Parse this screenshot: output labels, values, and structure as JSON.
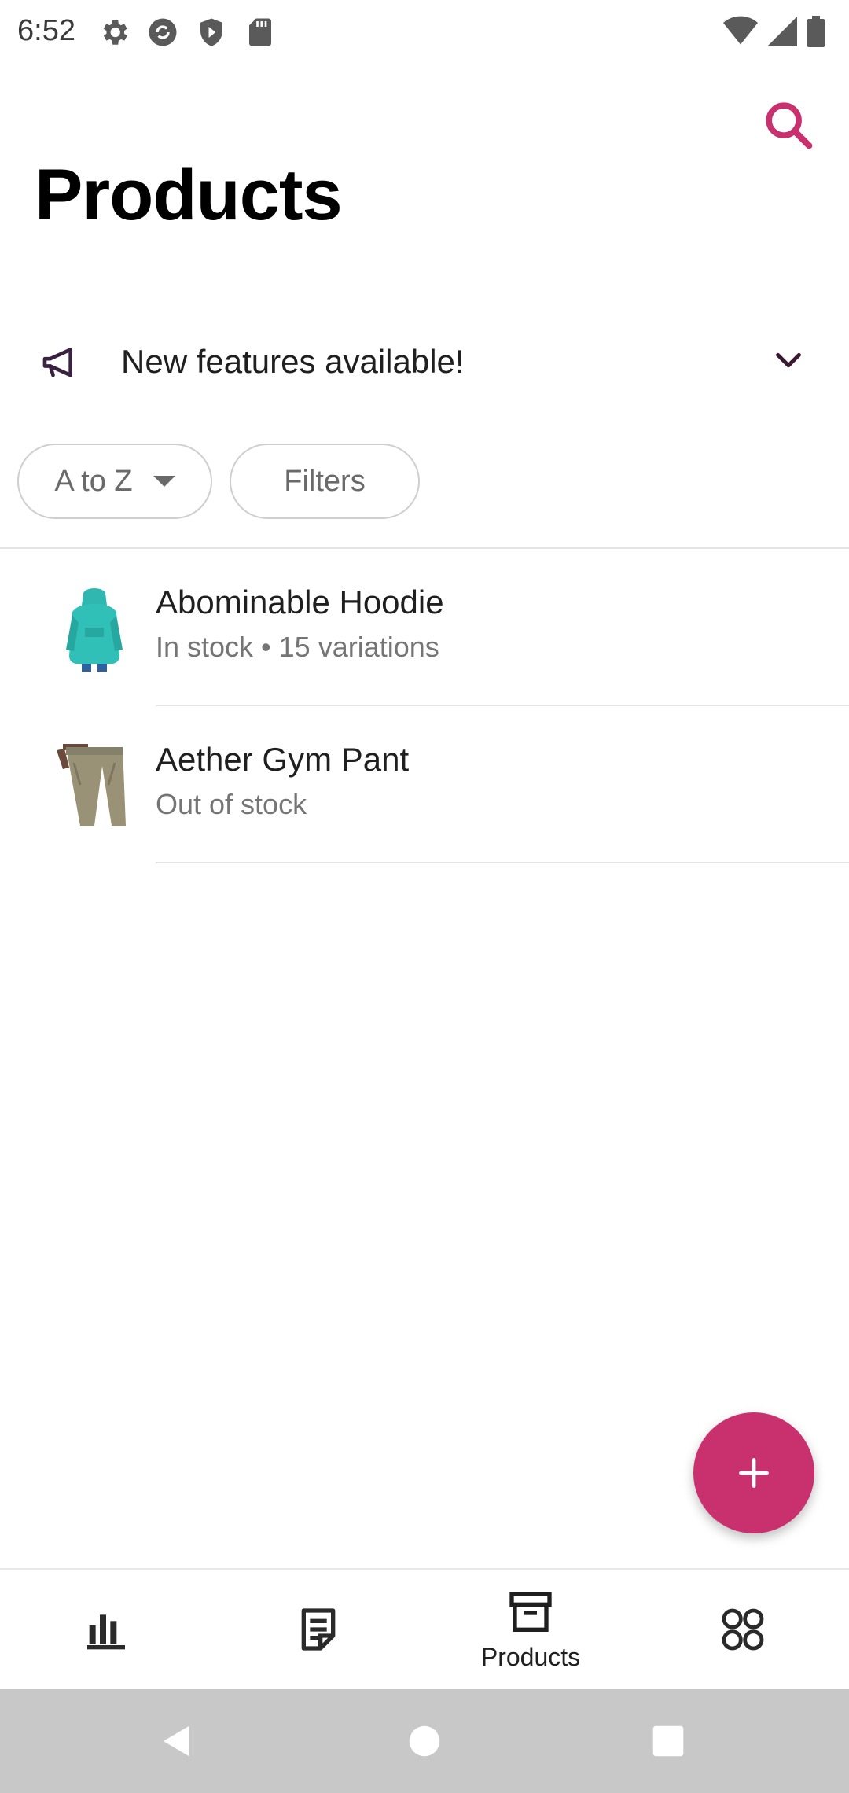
{
  "status_bar": {
    "time": "6:52",
    "left_icons": [
      "gear-icon",
      "sync-icon",
      "shield-icon",
      "sd-card-icon"
    ],
    "right_icons": [
      "wifi-icon",
      "cell-signal-icon",
      "battery-icon"
    ]
  },
  "header": {
    "title": "Products",
    "search_icon": "search-icon"
  },
  "banner": {
    "icon": "megaphone-icon",
    "text": "New features available!",
    "chevron": "chevron-down-icon"
  },
  "sort_chip": {
    "label": "A to Z"
  },
  "filter_chip": {
    "label": "Filters"
  },
  "products": [
    {
      "name": "Abominable Hoodie",
      "meta": "In stock • 15 variations",
      "thumb": "hoodie-image"
    },
    {
      "name": "Aether Gym Pant",
      "meta": "Out of stock",
      "thumb": "pants-image"
    }
  ],
  "fab": {
    "icon": "plus-icon"
  },
  "bottom_nav": {
    "items": [
      {
        "icon": "stats-icon",
        "label": ""
      },
      {
        "icon": "orders-icon",
        "label": ""
      },
      {
        "icon": "products-icon",
        "label": "Products"
      },
      {
        "icon": "menu-grid-icon",
        "label": ""
      }
    ]
  },
  "colors": {
    "accent": "#c9306e",
    "text_primary": "#1f1f1f",
    "text_secondary": "#757575"
  }
}
